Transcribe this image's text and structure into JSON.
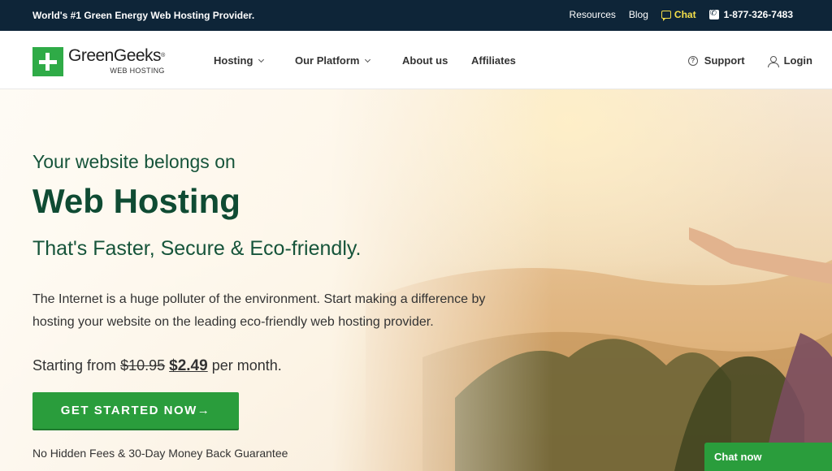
{
  "topbar": {
    "tagline": "World's #1 Green Energy Web Hosting Provider.",
    "links": [
      "Resources",
      "Blog"
    ],
    "chat_label": "Chat",
    "phone": "1-877-326-7483",
    "icons": {
      "chat": "chat-bubble-icon",
      "phone": "phone-icon"
    }
  },
  "nav": {
    "logo_name": "GreenGeeks",
    "logo_reg": "®",
    "logo_sub": "WEB HOSTING",
    "menu": [
      {
        "label": "Hosting",
        "dropdown": true
      },
      {
        "label": "Our Platform",
        "dropdown": true
      },
      {
        "label": "About us",
        "dropdown": false
      },
      {
        "label": "Affiliates",
        "dropdown": false
      }
    ],
    "support_label": "Support",
    "login_label": "Login"
  },
  "hero": {
    "pre_title": "Your website belongs on",
    "title": "Web Hosting",
    "subtitle": "That's Faster, Secure & Eco-friendly.",
    "description": "The Internet is a huge polluter of the environment. Start making a difference by hosting your website on the leading eco-friendly web hosting provider.",
    "price_prefix": "Starting from",
    "old_price": "$10.95",
    "new_price": "$2.49",
    "price_suffix": "per month.",
    "cta_label": "GET STARTED NOW→",
    "guarantee": "No Hidden Fees & 30-Day Money Back Guarantee"
  },
  "chat_widget": {
    "label": "Chat now"
  },
  "colors": {
    "topbar": "#0e2538",
    "brand_green": "#2fab47",
    "cta_green": "#2a9d3c",
    "heading_green": "#0f4b33",
    "chat_yellow": "#f5e04a"
  }
}
